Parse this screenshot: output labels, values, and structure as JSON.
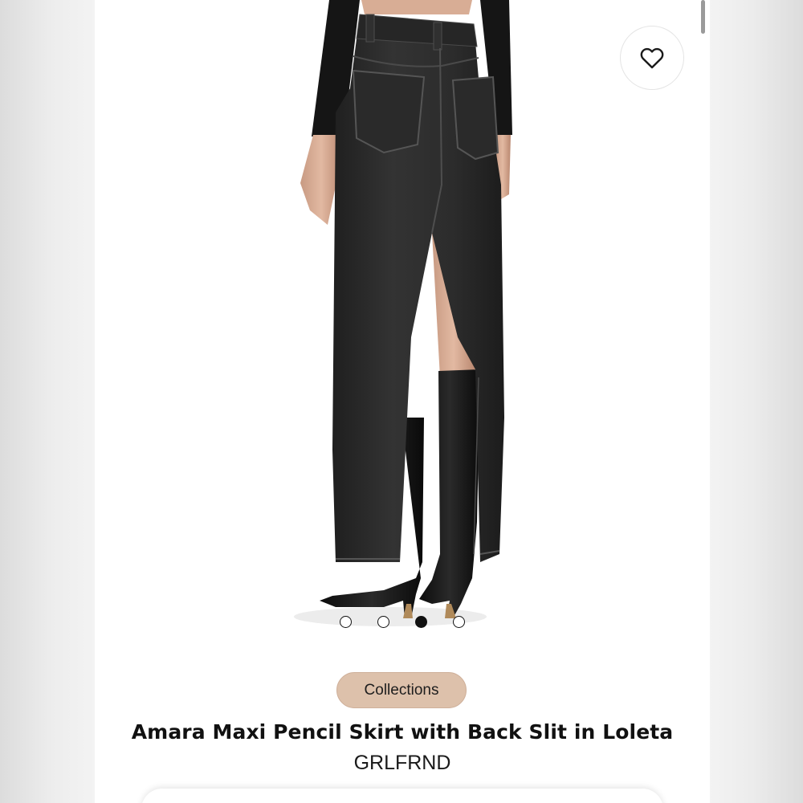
{
  "listing": {
    "category_chip": "Collections",
    "title": "Amara Maxi Pencil Skirt with Back Slit in Loleta",
    "brand": "GRLFRND"
  },
  "gallery": {
    "image_count": 4,
    "active_index": 3
  },
  "icons": {
    "favorite": "heart-icon"
  },
  "colors": {
    "chip_background": "#ddc1ab",
    "text_primary": "#111111",
    "denim": "#2c2c2c"
  }
}
